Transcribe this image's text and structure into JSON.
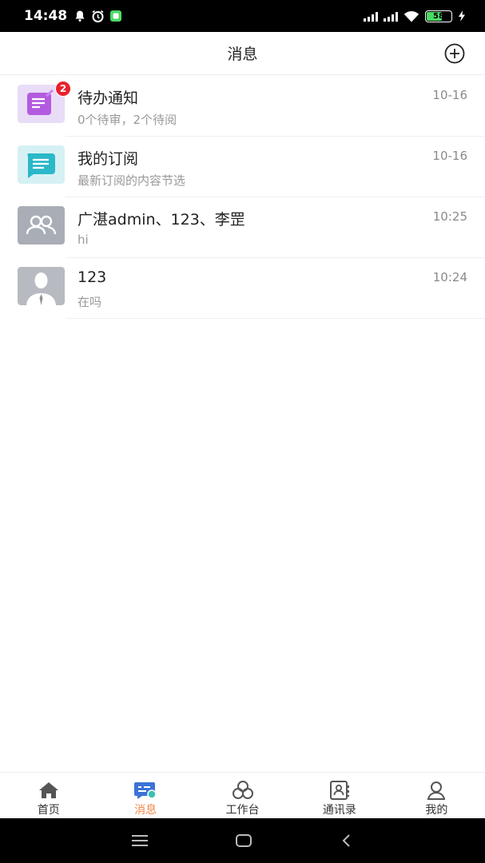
{
  "status_bar": {
    "time": "14:48",
    "battery": "58"
  },
  "header": {
    "title": "消息"
  },
  "messages": [
    {
      "title": "待办通知",
      "subtitle": "0个待审，2个待阅",
      "time": "10-16",
      "badge": "2",
      "icon": "todo-icon"
    },
    {
      "title": "我的订阅",
      "subtitle": "最新订阅的内容节选",
      "time": "10-16",
      "icon": "subscription-icon"
    },
    {
      "title": "广湛admin、123、李罡",
      "subtitle": "hi",
      "time": "10:25",
      "icon": "group-avatar-icon"
    },
    {
      "title": "123",
      "subtitle": "在吗",
      "time": "10:24",
      "icon": "user-avatar-icon"
    }
  ],
  "tabs": [
    {
      "label": "首页",
      "icon": "home-icon"
    },
    {
      "label": "消息",
      "icon": "message-icon",
      "active": true
    },
    {
      "label": "工作台",
      "icon": "workbench-icon"
    },
    {
      "label": "通讯录",
      "icon": "contacts-icon"
    },
    {
      "label": "我的",
      "icon": "profile-icon"
    }
  ],
  "colors": {
    "accent": "#f0894a",
    "badge": "#e8212b",
    "inactive": "#333333"
  }
}
